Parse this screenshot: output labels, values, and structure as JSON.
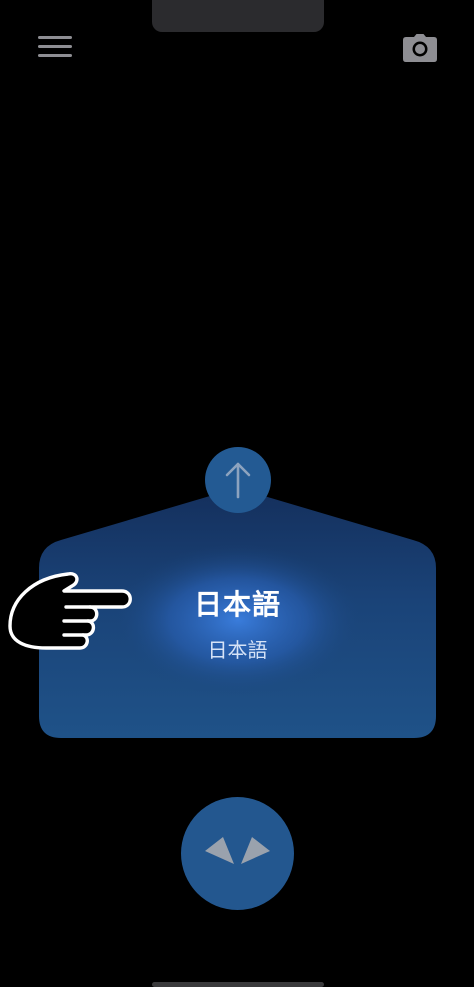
{
  "header": {
    "menu_icon": "hamburger-menu-icon",
    "camera_icon": "camera-icon"
  },
  "language_card": {
    "title": "日本語",
    "subtitle": "日本語",
    "up_icon": "arrow-up-icon",
    "pointer_icon": "pointing-hand-icon"
  },
  "swap_button": {
    "icon": "chevrons-swap-icon"
  },
  "colors": {
    "background": "#000000",
    "card_top": "#163a6e",
    "card_glow": "#2f6fd0",
    "card_bottom": "#1c4d80",
    "button": "#235a93",
    "icon_gray": "#8e8e93"
  }
}
